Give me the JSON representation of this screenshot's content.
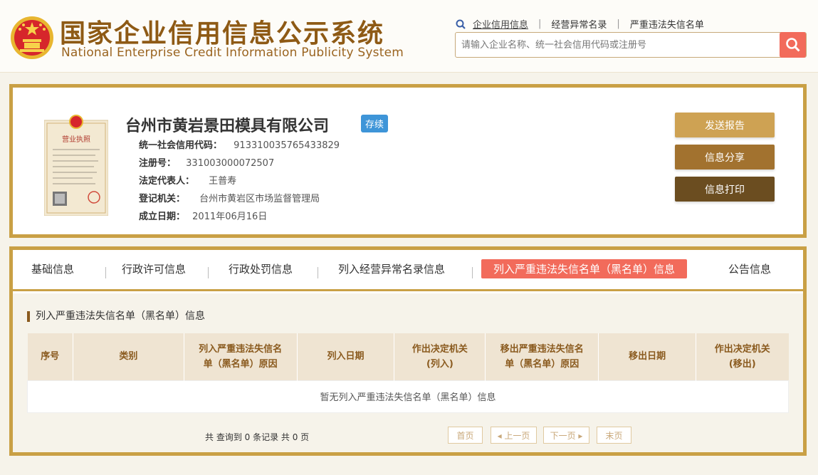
{
  "header": {
    "title_cn": "国家企业信用信息公示系统",
    "title_en": "National Enterprise Credit Information Publicity System",
    "links": [
      "企业信用信息",
      "经营异常名录",
      "严重违法失信名单"
    ],
    "search_placeholder": "请输入企业名称、统一社会信用代码或注册号"
  },
  "company": {
    "name": "台州市黄岩景田模具有限公司",
    "status": "存续",
    "fields": [
      {
        "label": "统一社会信用代码：",
        "value": "913310035765433829"
      },
      {
        "label": "注册号：",
        "value": "331003000072507"
      },
      {
        "label": "法定代表人：",
        "value": "王普寿"
      },
      {
        "label": "登记机关：",
        "value": "台州市黄岩区市场监督管理局"
      },
      {
        "label": "成立日期：",
        "value": "2011年06月16日"
      }
    ],
    "license_title": "营业执照"
  },
  "actions": {
    "report": "发送报告",
    "share": "信息分享",
    "print": "信息打印"
  },
  "tabs": [
    "基础信息",
    "行政许可信息",
    "行政处罚信息",
    "列入经营异常名录信息",
    "列入严重违法失信名单（黑名单）信息",
    "公告信息"
  ],
  "section": {
    "title": "列入严重违法失信名单（黑名单）信息",
    "columns": [
      [
        "序号"
      ],
      [
        "类别"
      ],
      [
        "列入严重违法失信名",
        "单（黑名单）原因"
      ],
      [
        "列入日期"
      ],
      [
        "作出决定机关",
        "(列入)"
      ],
      [
        "移出严重违法失信名",
        "单（黑名单）原因"
      ],
      [
        "移出日期"
      ],
      [
        "作出决定机关",
        "(移出)"
      ]
    ],
    "empty_text": "暂无列入严重违法失信名单（黑名单）信息",
    "count_text": "共 查询到 0 条记录 共 0 页"
  },
  "pagination": {
    "first": "首页",
    "prev": "◂ 上一页",
    "next": "下一页 ▸",
    "last": "末页"
  },
  "colors": {
    "brand": "#8e5a15",
    "gold_border": "#c9a045",
    "accent": "#f26b5b",
    "status_blue": "#3e95d8"
  }
}
